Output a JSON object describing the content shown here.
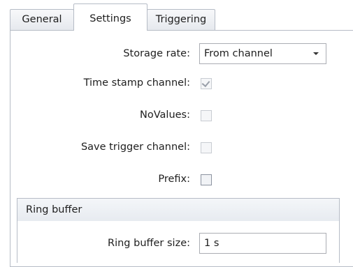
{
  "tabs": [
    {
      "label": "General",
      "active": false
    },
    {
      "label": "Settings",
      "active": true
    },
    {
      "label": "Triggering",
      "active": false
    }
  ],
  "settings": {
    "storage_rate": {
      "label": "Storage rate:",
      "value": "From channel"
    },
    "time_stamp_channel": {
      "label": "Time stamp channel:",
      "checked": true,
      "enabled": false
    },
    "no_values": {
      "label": "NoValues:",
      "checked": false,
      "enabled": false
    },
    "save_trigger_channel": {
      "label": "Save trigger channel:",
      "checked": false,
      "enabled": false
    },
    "prefix": {
      "label": "Prefix:",
      "checked": false,
      "enabled": true
    }
  },
  "ring_buffer": {
    "title": "Ring buffer",
    "size_label": "Ring buffer size:",
    "size_value": "1 s"
  },
  "colors": {
    "border": "#b6bcc6",
    "tab_bg": "#e6e9ee",
    "panel_bg": "#ffffff"
  }
}
